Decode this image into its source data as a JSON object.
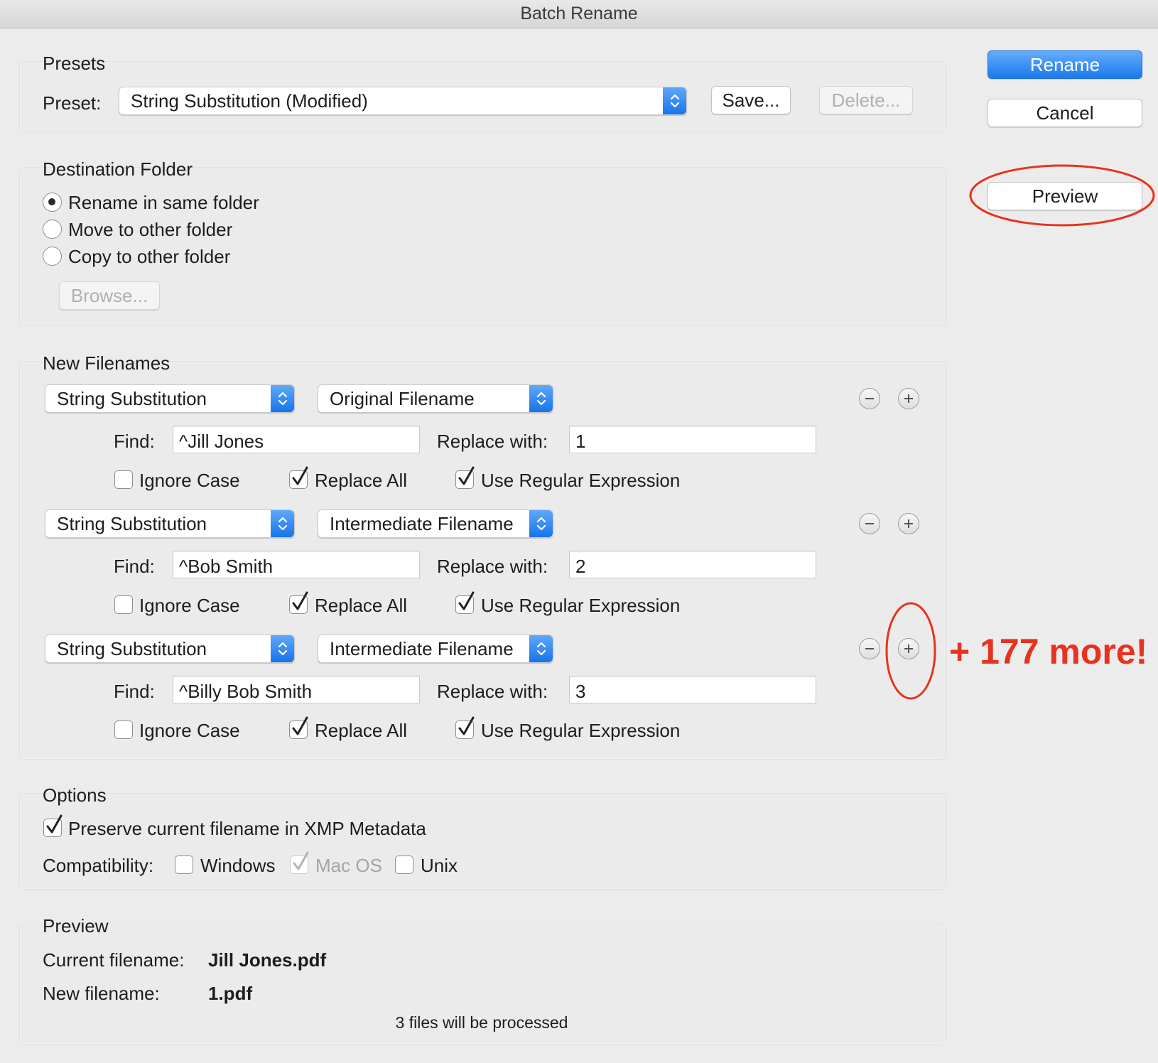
{
  "window": {
    "title": "Batch Rename"
  },
  "actions": {
    "rename": "Rename",
    "cancel": "Cancel",
    "preview": "Preview"
  },
  "presets": {
    "title": "Presets",
    "preset_label": "Preset:",
    "preset_value": "String Substitution (Modified)",
    "save": "Save...",
    "delete": "Delete..."
  },
  "destination": {
    "title": "Destination Folder",
    "options": [
      {
        "label": "Rename in same folder",
        "selected": true
      },
      {
        "label": "Move to other folder",
        "selected": false
      },
      {
        "label": "Copy to other folder",
        "selected": false
      }
    ],
    "browse": "Browse..."
  },
  "filenames": {
    "title": "New Filenames",
    "rules": [
      {
        "type": "String Substitution",
        "source": "Original Filename",
        "find_label": "Find:",
        "find": "^Jill Jones",
        "replace_label": "Replace with:",
        "replace": "1",
        "ignore_case": {
          "label": "Ignore Case",
          "checked": false
        },
        "replace_all": {
          "label": "Replace All",
          "checked": true
        },
        "use_regex": {
          "label": "Use Regular Expression",
          "checked": true
        }
      },
      {
        "type": "String Substitution",
        "source": "Intermediate Filename",
        "find_label": "Find:",
        "find": "^Bob Smith",
        "replace_label": "Replace with:",
        "replace": "2",
        "ignore_case": {
          "label": "Ignore Case",
          "checked": false
        },
        "replace_all": {
          "label": "Replace All",
          "checked": true
        },
        "use_regex": {
          "label": "Use Regular Expression",
          "checked": true
        }
      },
      {
        "type": "String Substitution",
        "source": "Intermediate Filename",
        "find_label": "Find:",
        "find": "^Billy Bob Smith",
        "replace_label": "Replace with:",
        "replace": "3",
        "ignore_case": {
          "label": "Ignore Case",
          "checked": false
        },
        "replace_all": {
          "label": "Replace All",
          "checked": true
        },
        "use_regex": {
          "label": "Use Regular Expression",
          "checked": true
        }
      }
    ]
  },
  "options": {
    "title": "Options",
    "preserve": {
      "label": "Preserve current filename in XMP Metadata",
      "checked": true
    },
    "compat_label": "Compatibility:",
    "windows": {
      "label": "Windows",
      "checked": false
    },
    "macos": {
      "label": "Mac OS",
      "checked": true,
      "disabled": true
    },
    "unix": {
      "label": "Unix",
      "checked": false
    }
  },
  "preview": {
    "title": "Preview",
    "current_label": "Current filename:",
    "current_value": "Jill Jones.pdf",
    "new_label": "New filename:",
    "new_value": "1.pdf",
    "count_text": "3 files will be processed"
  },
  "annotation": {
    "text": "+ 177 more!",
    "color": "#e8321f"
  },
  "colors": {
    "accent": "#1675ea",
    "annotation": "#e8321f"
  }
}
